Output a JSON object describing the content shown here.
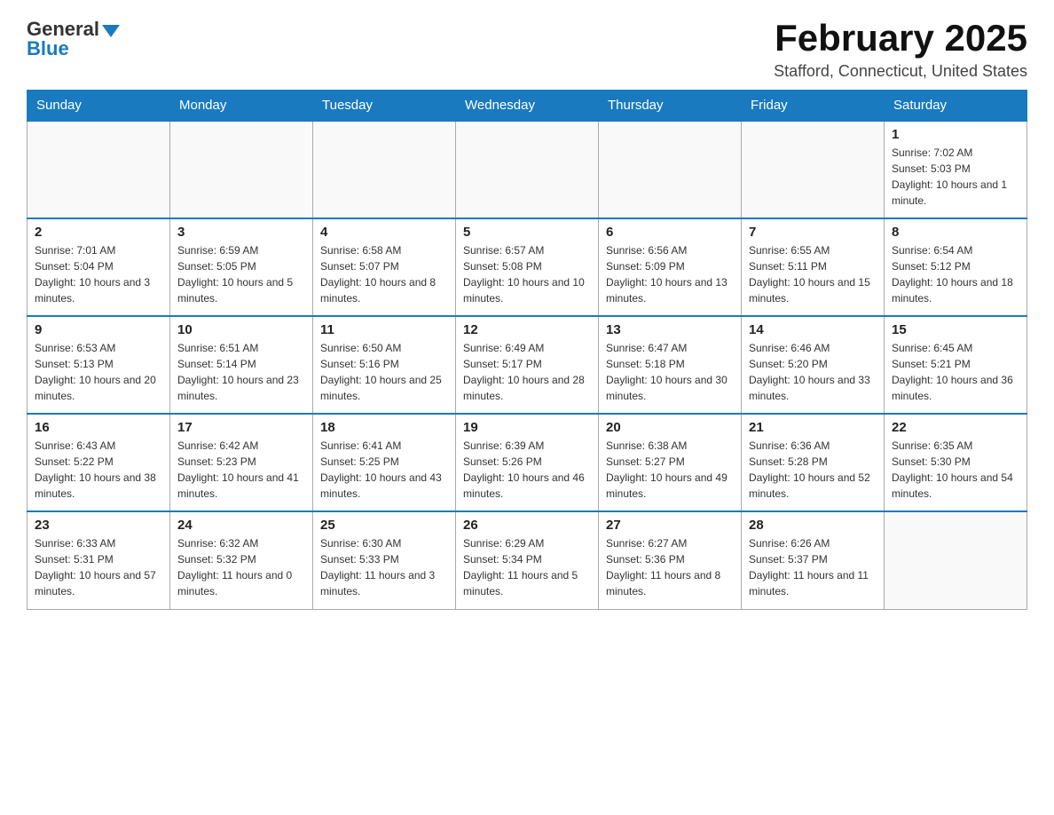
{
  "header": {
    "logo_general": "General",
    "logo_blue": "Blue",
    "month_title": "February 2025",
    "location": "Stafford, Connecticut, United States"
  },
  "days_of_week": [
    "Sunday",
    "Monday",
    "Tuesday",
    "Wednesday",
    "Thursday",
    "Friday",
    "Saturday"
  ],
  "weeks": [
    [
      {
        "day": "",
        "info": ""
      },
      {
        "day": "",
        "info": ""
      },
      {
        "day": "",
        "info": ""
      },
      {
        "day": "",
        "info": ""
      },
      {
        "day": "",
        "info": ""
      },
      {
        "day": "",
        "info": ""
      },
      {
        "day": "1",
        "info": "Sunrise: 7:02 AM\nSunset: 5:03 PM\nDaylight: 10 hours and 1 minute."
      }
    ],
    [
      {
        "day": "2",
        "info": "Sunrise: 7:01 AM\nSunset: 5:04 PM\nDaylight: 10 hours and 3 minutes."
      },
      {
        "day": "3",
        "info": "Sunrise: 6:59 AM\nSunset: 5:05 PM\nDaylight: 10 hours and 5 minutes."
      },
      {
        "day": "4",
        "info": "Sunrise: 6:58 AM\nSunset: 5:07 PM\nDaylight: 10 hours and 8 minutes."
      },
      {
        "day": "5",
        "info": "Sunrise: 6:57 AM\nSunset: 5:08 PM\nDaylight: 10 hours and 10 minutes."
      },
      {
        "day": "6",
        "info": "Sunrise: 6:56 AM\nSunset: 5:09 PM\nDaylight: 10 hours and 13 minutes."
      },
      {
        "day": "7",
        "info": "Sunrise: 6:55 AM\nSunset: 5:11 PM\nDaylight: 10 hours and 15 minutes."
      },
      {
        "day": "8",
        "info": "Sunrise: 6:54 AM\nSunset: 5:12 PM\nDaylight: 10 hours and 18 minutes."
      }
    ],
    [
      {
        "day": "9",
        "info": "Sunrise: 6:53 AM\nSunset: 5:13 PM\nDaylight: 10 hours and 20 minutes."
      },
      {
        "day": "10",
        "info": "Sunrise: 6:51 AM\nSunset: 5:14 PM\nDaylight: 10 hours and 23 minutes."
      },
      {
        "day": "11",
        "info": "Sunrise: 6:50 AM\nSunset: 5:16 PM\nDaylight: 10 hours and 25 minutes."
      },
      {
        "day": "12",
        "info": "Sunrise: 6:49 AM\nSunset: 5:17 PM\nDaylight: 10 hours and 28 minutes."
      },
      {
        "day": "13",
        "info": "Sunrise: 6:47 AM\nSunset: 5:18 PM\nDaylight: 10 hours and 30 minutes."
      },
      {
        "day": "14",
        "info": "Sunrise: 6:46 AM\nSunset: 5:20 PM\nDaylight: 10 hours and 33 minutes."
      },
      {
        "day": "15",
        "info": "Sunrise: 6:45 AM\nSunset: 5:21 PM\nDaylight: 10 hours and 36 minutes."
      }
    ],
    [
      {
        "day": "16",
        "info": "Sunrise: 6:43 AM\nSunset: 5:22 PM\nDaylight: 10 hours and 38 minutes."
      },
      {
        "day": "17",
        "info": "Sunrise: 6:42 AM\nSunset: 5:23 PM\nDaylight: 10 hours and 41 minutes."
      },
      {
        "day": "18",
        "info": "Sunrise: 6:41 AM\nSunset: 5:25 PM\nDaylight: 10 hours and 43 minutes."
      },
      {
        "day": "19",
        "info": "Sunrise: 6:39 AM\nSunset: 5:26 PM\nDaylight: 10 hours and 46 minutes."
      },
      {
        "day": "20",
        "info": "Sunrise: 6:38 AM\nSunset: 5:27 PM\nDaylight: 10 hours and 49 minutes."
      },
      {
        "day": "21",
        "info": "Sunrise: 6:36 AM\nSunset: 5:28 PM\nDaylight: 10 hours and 52 minutes."
      },
      {
        "day": "22",
        "info": "Sunrise: 6:35 AM\nSunset: 5:30 PM\nDaylight: 10 hours and 54 minutes."
      }
    ],
    [
      {
        "day": "23",
        "info": "Sunrise: 6:33 AM\nSunset: 5:31 PM\nDaylight: 10 hours and 57 minutes."
      },
      {
        "day": "24",
        "info": "Sunrise: 6:32 AM\nSunset: 5:32 PM\nDaylight: 11 hours and 0 minutes."
      },
      {
        "day": "25",
        "info": "Sunrise: 6:30 AM\nSunset: 5:33 PM\nDaylight: 11 hours and 3 minutes."
      },
      {
        "day": "26",
        "info": "Sunrise: 6:29 AM\nSunset: 5:34 PM\nDaylight: 11 hours and 5 minutes."
      },
      {
        "day": "27",
        "info": "Sunrise: 6:27 AM\nSunset: 5:36 PM\nDaylight: 11 hours and 8 minutes."
      },
      {
        "day": "28",
        "info": "Sunrise: 6:26 AM\nSunset: 5:37 PM\nDaylight: 11 hours and 11 minutes."
      },
      {
        "day": "",
        "info": ""
      }
    ]
  ]
}
